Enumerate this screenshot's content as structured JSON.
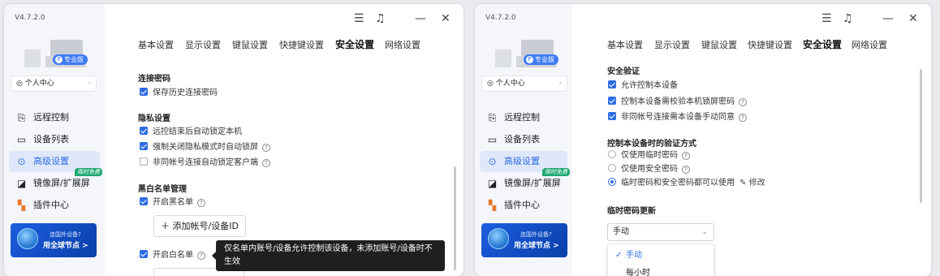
{
  "app": {
    "version": "V4.7.2.0",
    "pro_badge": "专业版",
    "personal_center": "个人中心"
  },
  "nav": {
    "remote": "远程控制",
    "devices": "设备列表",
    "advanced": "高级设置",
    "mirror": "镜像屏/扩展屏",
    "plugins": "插件中心",
    "free_badge": "限时免费"
  },
  "promo": {
    "line1": "连国外设备?",
    "line2": "用全球节点 >"
  },
  "tabs": [
    "基本设置",
    "显示设置",
    "键鼠设置",
    "快捷键设置",
    "安全设置",
    "网络设置"
  ],
  "left": {
    "conn_title": "连接密码",
    "save_history": "保存历史连接密码",
    "privacy_title": "隐私设置",
    "auto_lock": "远控结束后自动锁定本机",
    "force_lock": "强制关闭隐私模式时自动锁屏",
    "non_same_lock": "非同帐号连接自动锁定客户端",
    "blacklist_title": "黑白名单管理",
    "enable_black": "开启黑名单",
    "add_account": "添加帐号/设备ID",
    "enable_white": "开启白名单",
    "tooltip": "仅名单内账号/设备允许控制该设备，未添加账号/设备时不生效"
  },
  "right": {
    "verify_title": "安全验证",
    "allow_control": "允许控制本设备",
    "check_lock_pwd": "控制本设备需校验本机锁屏密码",
    "non_same_confirm": "非同帐号连接需本设备手动同意",
    "method_title": "控制本设备时的验证方式",
    "temp_only": "仅使用临时密码",
    "safe_only": "仅使用安全密码",
    "both": "临时密码和安全密码都可以使用",
    "modify": "修改",
    "update_title": "临时密码更新",
    "select_value": "手动",
    "options": [
      "手动",
      "每小时"
    ]
  }
}
